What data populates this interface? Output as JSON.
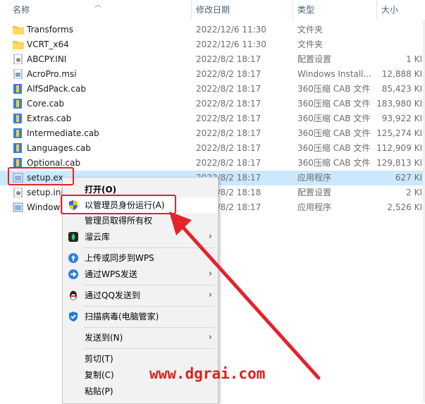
{
  "columns": {
    "name": "名称",
    "date": "修改日期",
    "type": "类型",
    "size": "大小"
  },
  "files": [
    {
      "name": "Transforms",
      "date": "2022/12/6 11:30",
      "type": "文件夹",
      "size": "",
      "icon": "folder-icon"
    },
    {
      "name": "VCRT_x64",
      "date": "2022/12/6 11:30",
      "type": "文件夹",
      "size": "",
      "icon": "folder-icon"
    },
    {
      "name": "ABCPY.INI",
      "date": "2022/8/2 18:17",
      "type": "配置设置",
      "size": "1 KI",
      "icon": "ini-file-icon"
    },
    {
      "name": "AcroPro.msi",
      "date": "2022/8/2 18:17",
      "type": "Windows Install...",
      "size": "12,888 KI",
      "icon": "msi-file-icon"
    },
    {
      "name": "AlfSdPack.cab",
      "date": "2022/8/2 18:17",
      "type": "360压缩 CAB 文件",
      "size": "85,423 KI",
      "icon": "cab-file-icon"
    },
    {
      "name": "Core.cab",
      "date": "2022/8/2 18:17",
      "type": "360压缩 CAB 文件",
      "size": "183,980 KI",
      "icon": "cab-file-icon"
    },
    {
      "name": "Extras.cab",
      "date": "2022/8/2 18:17",
      "type": "360压缩 CAB 文件",
      "size": "93,922 KI",
      "icon": "cab-file-icon"
    },
    {
      "name": "Intermediate.cab",
      "date": "2022/8/2 18:17",
      "type": "360压缩 CAB 文件",
      "size": "125,274 KI",
      "icon": "cab-file-icon"
    },
    {
      "name": "Languages.cab",
      "date": "2022/8/2 18:17",
      "type": "360压缩 CAB 文件",
      "size": "112,909 KI",
      "icon": "cab-file-icon"
    },
    {
      "name": "Optional.cab",
      "date": "2022/8/2 18:17",
      "type": "360压缩 CAB 文件",
      "size": "129,813 KI",
      "icon": "cab-file-icon"
    },
    {
      "name": "setup.ex",
      "date": "2022/8/2 18:17",
      "type": "应用程序",
      "size": "627 KI",
      "icon": "exe-file-icon"
    },
    {
      "name": "setup.ini",
      "date": "2022/8/2 18:18",
      "type": "配置设置",
      "size": "2 KI",
      "icon": "ini-file-icon"
    },
    {
      "name": "Window",
      "date": "2022/8/2 18:17",
      "type": "应用程序",
      "size": "2,526 KI",
      "icon": "exe-file-icon"
    }
  ],
  "context_menu": {
    "open": "打开(O)",
    "run_as_admin": "以管理员身份运行(A)",
    "take_ownership": "管理员取得所有权",
    "liuyunku": "溜云库",
    "upload_wps": "上传或同步到WPS",
    "send_wps": "通过WPS发送",
    "send_qq": "通过QQ发送到",
    "scan_virus": "扫描病毒(电脑管家)",
    "send_to": "发送到(N)",
    "cut": "剪切(T)",
    "copy": "复制(C)",
    "paste": "粘贴(P)"
  },
  "watermark": "www.dgrai.com",
  "colors": {
    "accent": "#cce8ff",
    "annotation": "#e4232a"
  }
}
